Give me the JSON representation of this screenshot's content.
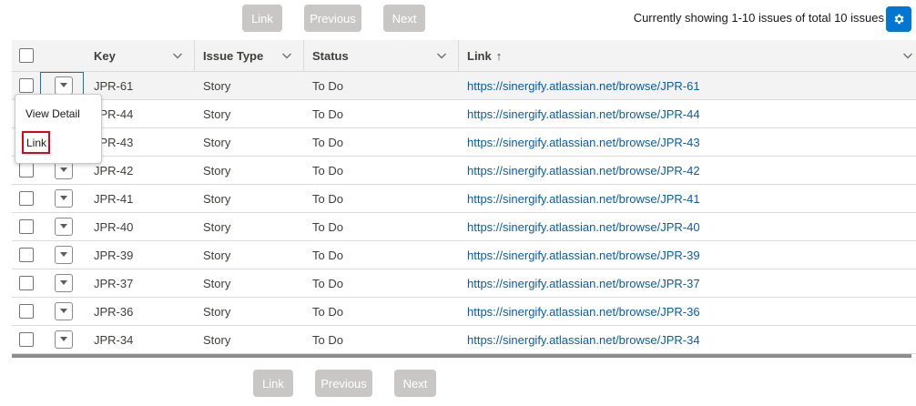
{
  "pagination_top": {
    "link": "Link",
    "previous": "Previous",
    "next": "Next"
  },
  "status": "Currently showing 1-10 issues of total 10 issues",
  "settings_icon": "gear-icon",
  "table": {
    "columns": {
      "key": "Key",
      "issue_type": "Issue Type",
      "status": "Status",
      "link": "Link",
      "link_sort": "↑"
    },
    "rows": [
      {
        "key": "JPR-61",
        "type": "Story",
        "status": "To Do",
        "link": "https://sinergify.atlassian.net/browse/JPR-61"
      },
      {
        "key": "JPR-44",
        "type": "Story",
        "status": "To Do",
        "link": "https://sinergify.atlassian.net/browse/JPR-44"
      },
      {
        "key": "JPR-43",
        "type": "Story",
        "status": "To Do",
        "link": "https://sinergify.atlassian.net/browse/JPR-43"
      },
      {
        "key": "JPR-42",
        "type": "Story",
        "status": "To Do",
        "link": "https://sinergify.atlassian.net/browse/JPR-42"
      },
      {
        "key": "JPR-41",
        "type": "Story",
        "status": "To Do",
        "link": "https://sinergify.atlassian.net/browse/JPR-41"
      },
      {
        "key": "JPR-40",
        "type": "Story",
        "status": "To Do",
        "link": "https://sinergify.atlassian.net/browse/JPR-40"
      },
      {
        "key": "JPR-39",
        "type": "Story",
        "status": "To Do",
        "link": "https://sinergify.atlassian.net/browse/JPR-39"
      },
      {
        "key": "JPR-37",
        "type": "Story",
        "status": "To Do",
        "link": "https://sinergify.atlassian.net/browse/JPR-37"
      },
      {
        "key": "JPR-36",
        "type": "Story",
        "status": "To Do",
        "link": "https://sinergify.atlassian.net/browse/JPR-36"
      },
      {
        "key": "JPR-34",
        "type": "Story",
        "status": "To Do",
        "link": "https://sinergify.atlassian.net/browse/JPR-34"
      }
    ]
  },
  "row_menu": {
    "view_detail": "View Detail",
    "link": "Link"
  },
  "pagination_bottom": {
    "link": "Link",
    "previous": "Previous",
    "next": "Next"
  },
  "colors": {
    "accent": "#0176d3",
    "link": "#0b5cab",
    "disabled_button": "#c9c7c5",
    "highlight": "#e1001c"
  }
}
